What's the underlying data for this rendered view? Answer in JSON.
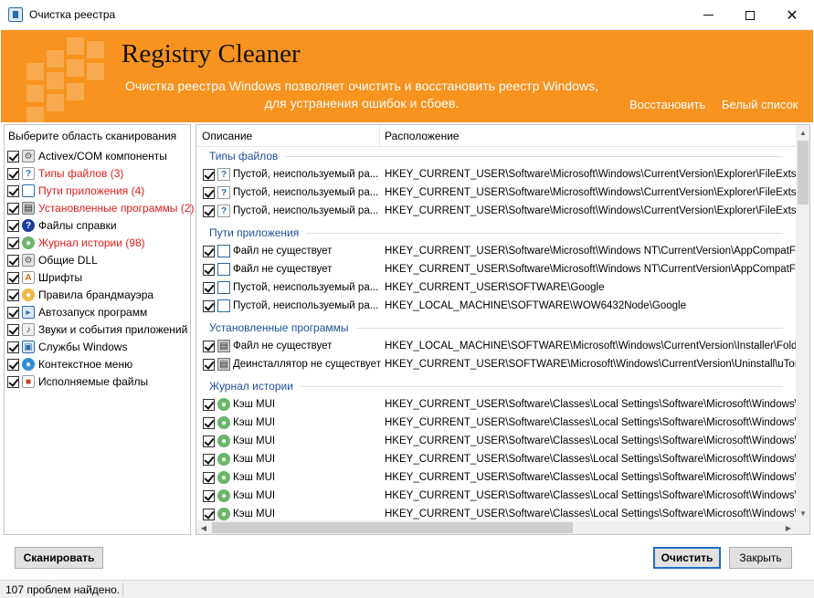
{
  "window": {
    "title": "Очистка реестра"
  },
  "banner": {
    "heading": "Registry Cleaner",
    "description": "Очистка реестра Windows позволяет очистить и восстановить реестр Windows, для устранения ошибок и сбоев.",
    "restore_link": "Восстановить",
    "whitelist_link": "Белый список",
    "color": "#f7931e"
  },
  "left": {
    "header": "Выберите область сканирования",
    "categories": [
      {
        "label": "Activex/COM компоненты",
        "icon": "gear-icon",
        "checked": true,
        "highlight": false
      },
      {
        "label": "Типы файлов (3)",
        "icon": "file-type-icon",
        "checked": true,
        "highlight": true
      },
      {
        "label": "Пути приложения (4)",
        "icon": "window-icon",
        "checked": true,
        "highlight": true
      },
      {
        "label": "Установленные программы (2)",
        "icon": "installer-icon",
        "checked": true,
        "highlight": true
      },
      {
        "label": "Файлы справки",
        "icon": "help-icon",
        "checked": true,
        "highlight": false
      },
      {
        "label": "Журнал истории (98)",
        "icon": "globe-icon",
        "checked": true,
        "highlight": true
      },
      {
        "label": "Общие DLL",
        "icon": "dll-icon",
        "checked": true,
        "highlight": false
      },
      {
        "label": "Шрифты",
        "icon": "font-icon",
        "checked": true,
        "highlight": false
      },
      {
        "label": "Правила брандмауэра",
        "icon": "firewall-icon",
        "checked": true,
        "highlight": false
      },
      {
        "label": "Автозапуск программ",
        "icon": "autorun-icon",
        "checked": true,
        "highlight": false
      },
      {
        "label": "Звуки и события приложений",
        "icon": "sound-icon",
        "checked": true,
        "highlight": false
      },
      {
        "label": "Службы Windows",
        "icon": "services-icon",
        "checked": true,
        "highlight": false
      },
      {
        "label": "Контекстное меню",
        "icon": "context-menu-icon",
        "checked": true,
        "highlight": false
      },
      {
        "label": "Исполняемые файлы",
        "icon": "executable-icon",
        "checked": true,
        "highlight": false
      }
    ]
  },
  "table": {
    "col_description": "Описание",
    "col_location": "Расположение",
    "groups": [
      {
        "name": "Типы файлов",
        "rows": [
          {
            "icon": "file-type-icon",
            "desc": "Пустой, неиспользуемый ра...",
            "path": "HKEY_CURRENT_USER\\Software\\Microsoft\\Windows\\CurrentVersion\\Explorer\\FileExts\\.odg"
          },
          {
            "icon": "file-type-icon",
            "desc": "Пустой, неиспользуемый ра...",
            "path": "HKEY_CURRENT_USER\\Software\\Microsoft\\Windows\\CurrentVersion\\Explorer\\FileExts\\.svg"
          },
          {
            "icon": "file-type-icon",
            "desc": "Пустой, неиспользуемый ра...",
            "path": "HKEY_CURRENT_USER\\Software\\Microsoft\\Windows\\CurrentVersion\\Explorer\\FileExts\\.xhtml"
          }
        ]
      },
      {
        "name": "Пути приложения",
        "rows": [
          {
            "icon": "window-icon",
            "desc": "Файл не существует",
            "path": "HKEY_CURRENT_USER\\Software\\Microsoft\\Windows NT\\CurrentVersion\\AppCompatFlags\\Co"
          },
          {
            "icon": "window-icon",
            "desc": "Файл не существует",
            "path": "HKEY_CURRENT_USER\\Software\\Microsoft\\Windows NT\\CurrentVersion\\AppCompatFlags\\Co"
          },
          {
            "icon": "window-icon",
            "desc": "Пустой, неиспользуемый ра...",
            "path": "HKEY_CURRENT_USER\\SOFTWARE\\Google"
          },
          {
            "icon": "window-icon",
            "desc": "Пустой, неиспользуемый ра...",
            "path": "HKEY_LOCAL_MACHINE\\SOFTWARE\\WOW6432Node\\Google"
          }
        ]
      },
      {
        "name": "Установленные программы",
        "rows": [
          {
            "icon": "installer-icon",
            "desc": "Файл не существует",
            "path": "HKEY_LOCAL_MACHINE\\SOFTWARE\\Microsoft\\Windows\\CurrentVersion\\Installer\\Folders"
          },
          {
            "icon": "installer-icon",
            "desc": "Деинсталлятор не существует",
            "path": "HKEY_CURRENT_USER\\SOFTWARE\\Microsoft\\Windows\\CurrentVersion\\Uninstall\\uTorrent"
          }
        ]
      },
      {
        "name": "Журнал истории",
        "rows": [
          {
            "icon": "globe-icon",
            "desc": "Кэш MUI",
            "path": "HKEY_CURRENT_USER\\Software\\Classes\\Local Settings\\Software\\Microsoft\\Windows\\Shell\\M"
          },
          {
            "icon": "globe-icon",
            "desc": "Кэш MUI",
            "path": "HKEY_CURRENT_USER\\Software\\Classes\\Local Settings\\Software\\Microsoft\\Windows\\Shell\\M"
          },
          {
            "icon": "globe-icon",
            "desc": "Кэш MUI",
            "path": "HKEY_CURRENT_USER\\Software\\Classes\\Local Settings\\Software\\Microsoft\\Windows\\Shell\\M"
          },
          {
            "icon": "globe-icon",
            "desc": "Кэш MUI",
            "path": "HKEY_CURRENT_USER\\Software\\Classes\\Local Settings\\Software\\Microsoft\\Windows\\Shell\\M"
          },
          {
            "icon": "globe-icon",
            "desc": "Кэш MUI",
            "path": "HKEY_CURRENT_USER\\Software\\Classes\\Local Settings\\Software\\Microsoft\\Windows\\Shell\\M"
          },
          {
            "icon": "globe-icon",
            "desc": "Кэш MUI",
            "path": "HKEY_CURRENT_USER\\Software\\Classes\\Local Settings\\Software\\Microsoft\\Windows\\Shell\\M"
          },
          {
            "icon": "globe-icon",
            "desc": "Кэш MUI",
            "path": "HKEY_CURRENT_USER\\Software\\Classes\\Local Settings\\Software\\Microsoft\\Windows\\Shell\\M"
          }
        ]
      }
    ]
  },
  "buttons": {
    "scan": "Сканировать",
    "clean": "Очистить",
    "close": "Закрыть"
  },
  "status": {
    "text": "107  проблем найдено."
  }
}
